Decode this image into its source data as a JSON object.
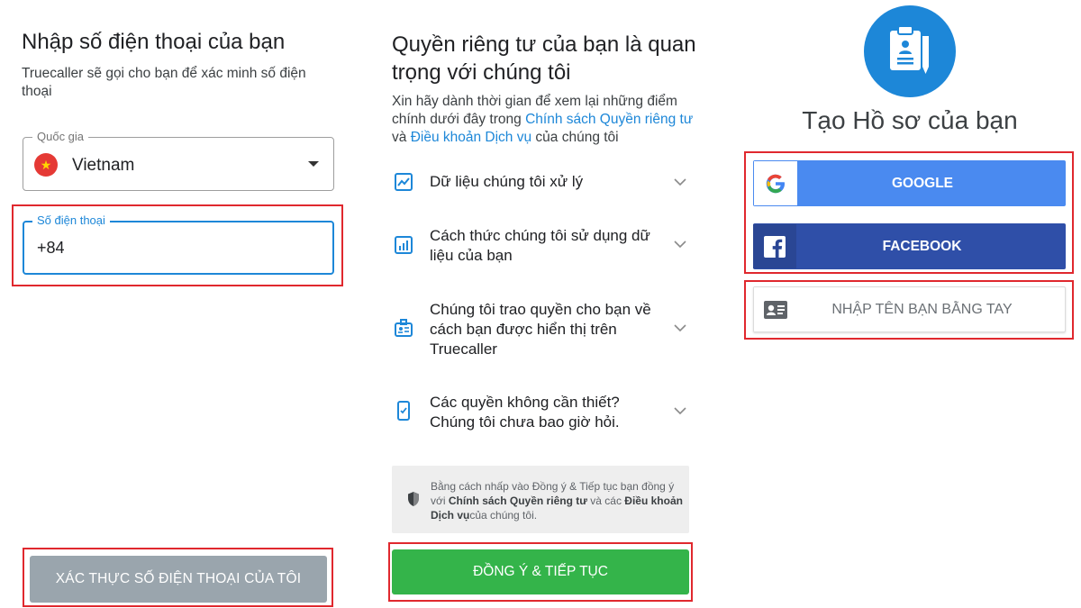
{
  "screen1": {
    "title": "Nhập số điện thoại của bạn",
    "subtitle": "Truecaller sẽ gọi cho bạn để xác minh số điện thoại",
    "country_label": "Quốc gia",
    "country_value": "Vietnam",
    "country_flag_icon": "vietnam-flag-icon",
    "phone_label": "Số điện thoại",
    "phone_value": "+84",
    "verify_button": "XÁC THỰC SỐ ĐIỆN THOẠI CỦA TÔI"
  },
  "screen2": {
    "title": "Quyền riêng tư của bạn là quan trọng với chúng tôi",
    "intro_prefix": "Xin hãy dành thời gian để xem lại những điểm chính dưới đây trong ",
    "intro_link1": "Chính sách Quyền riêng tư",
    "intro_mid": " và ",
    "intro_link2": "Điều khoản Dịch vụ",
    "intro_suffix": " của chúng tôi",
    "items": [
      {
        "label": "Dữ liệu chúng tôi xử lý",
        "icon": "chart-icon"
      },
      {
        "label": "Cách thức chúng tôi sử dụng dữ liệu của bạn",
        "icon": "bar-chart-icon"
      },
      {
        "label": "Chúng tôi trao quyền cho bạn về cách bạn được hiển thị trên Truecaller",
        "icon": "id-badge-icon"
      },
      {
        "label": "Các quyền không cần thiết? Chúng tôi chưa bao giờ hỏi.",
        "icon": "phone-check-icon"
      }
    ],
    "notice_prefix": "Bằng cách nhấp vào Đồng ý & Tiếp tục bạn đồng ý với ",
    "notice_bold1": "Chính sách Quyền riêng tư",
    "notice_mid": " và các ",
    "notice_bold2": "Điều khoản Dịch vụ",
    "notice_suffix": "của chúng tôi.",
    "agree_button": "ĐỒNG Ý & TIẾP TỤC"
  },
  "screen3": {
    "title": "Tạo Hồ sơ của bạn",
    "google_button": "GOOGLE",
    "facebook_button": "FACEBOOK",
    "manual_button": "NHẬP TÊN BẠN BẰNG TAY"
  },
  "colors": {
    "accent_blue": "#1d87d8",
    "green": "#34b44a",
    "google_blue": "#4a8af0",
    "facebook_blue": "#2f4fa8",
    "disabled_gray": "#9aa5ad",
    "highlight_red": "#e0282e"
  }
}
